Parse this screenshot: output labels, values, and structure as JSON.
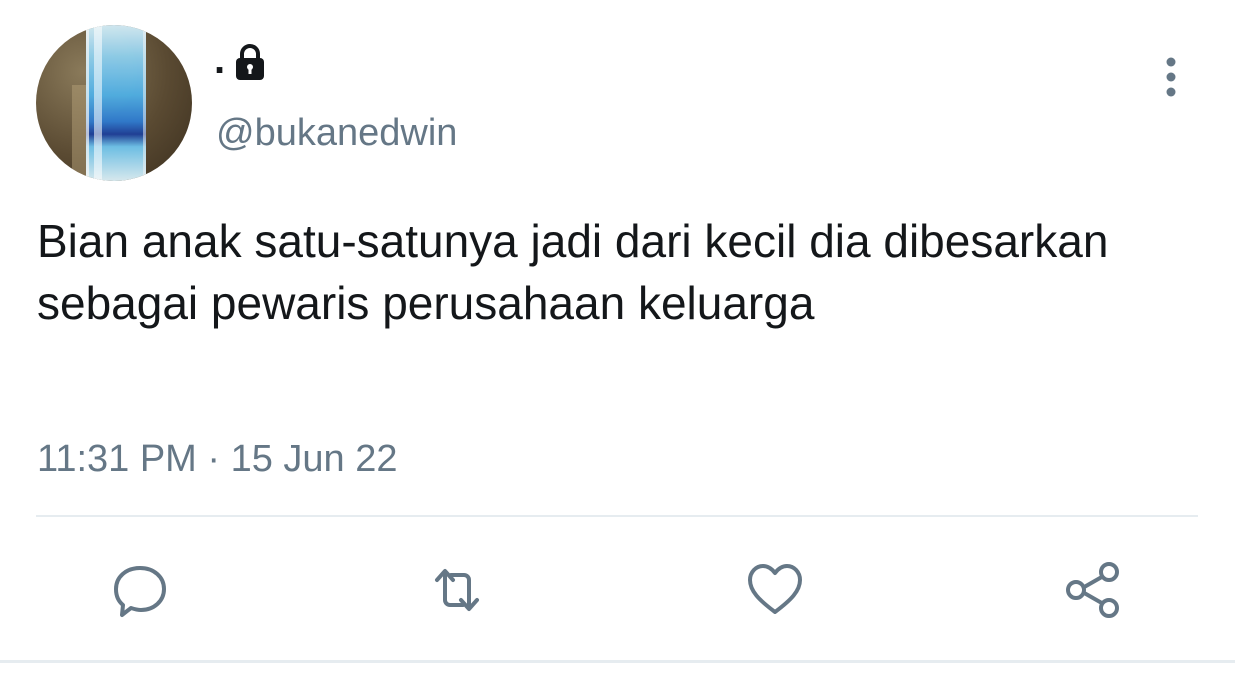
{
  "tweet": {
    "display_name": ".",
    "username": "@bukanedwin",
    "text": "Bian anak satu-satunya jadi dari kecil dia dibesarkan sebagai pewaris perusahaan keluarga",
    "timestamp": "11:31 PM · 15 Jun 22"
  },
  "icons": {
    "lock": "lock-icon",
    "more": "more-vertical-icon",
    "reply": "reply-icon",
    "retweet": "retweet-icon",
    "like": "heart-icon",
    "share": "share-icon"
  },
  "colors": {
    "text": "#14171a",
    "secondary": "#657786",
    "divider": "#e6ecf0",
    "background": "#ffffff"
  }
}
